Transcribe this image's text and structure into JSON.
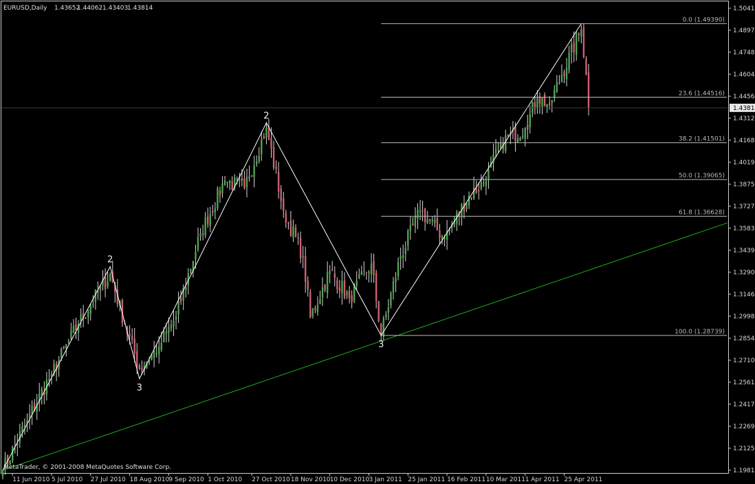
{
  "header": {
    "symbol": "EURUSD,Daily",
    "open": "1.43652",
    "high": "1.44062",
    "low": "1.43403",
    "close": "1.43814"
  },
  "footer": "MetaTrader, © 2001-2008 MetaQuotes Software Corp.",
  "colors": {
    "background": "#000000",
    "bull": "#4ea64e",
    "bear": "#d06070",
    "wick": "#d8d8d8",
    "trendline": "#22aa22",
    "fibonacci": "#bdbdbd",
    "zigzag": "#ffffff",
    "axis_text": "#d8d8d8",
    "current_price_box": "#e8e8e8"
  },
  "chart_data": {
    "type": "candlestick",
    "y_axis_ticks": [
      "1.50410",
      "1.48970",
      "1.47485",
      "1.46045",
      "1.44560",
      "1.43120",
      "1.41680",
      "1.40195",
      "1.38755",
      "1.37270",
      "1.35830",
      "1.34390",
      "1.32905",
      "1.31465",
      "1.29980",
      "1.28540",
      "1.27100",
      "1.25615",
      "1.24175",
      "1.22690",
      "1.21250",
      "1.19810"
    ],
    "x_axis_ticks": [
      "11 Jun 2010",
      "5 Jul 2010",
      "27 Jul 2010",
      "18 Aug 2010",
      "9 Sep 2010",
      "1 Oct 2010",
      "27 Oct 2010",
      "18 Nov 2010",
      "10 Dec 2010",
      "3 Jan 2011",
      "25 Jan 2011",
      "16 Feb 2011",
      "10 Mar 2011",
      "1 Apr 2011",
      "25 Apr 2011"
    ],
    "ylim": [
      1.1981,
      1.5041
    ],
    "current_price": "1.43814",
    "waypoints": [
      {
        "date": "2010-06-07",
        "close": 1.1981
      },
      {
        "date": "2010-06-21",
        "close": 1.231
      },
      {
        "date": "2010-07-05",
        "close": 1.262
      },
      {
        "date": "2010-07-20",
        "close": 1.295
      },
      {
        "date": "2010-08-06",
        "close": 1.328
      },
      {
        "date": "2010-08-15",
        "close": 1.295
      },
      {
        "date": "2010-08-24",
        "close": 1.265
      },
      {
        "date": "2010-09-03",
        "close": 1.28
      },
      {
        "date": "2010-09-14",
        "close": 1.3
      },
      {
        "date": "2010-09-28",
        "close": 1.355
      },
      {
        "date": "2010-10-12",
        "close": 1.39
      },
      {
        "date": "2010-10-22",
        "close": 1.385
      },
      {
        "date": "2010-11-04",
        "close": 1.425
      },
      {
        "date": "2010-11-15",
        "close": 1.37
      },
      {
        "date": "2010-11-25",
        "close": 1.34
      },
      {
        "date": "2010-11-30",
        "close": 1.299
      },
      {
        "date": "2010-12-10",
        "close": 1.33
      },
      {
        "date": "2010-12-22",
        "close": 1.312
      },
      {
        "date": "2011-01-04",
        "close": 1.335
      },
      {
        "date": "2011-01-10",
        "close": 1.288
      },
      {
        "date": "2011-01-20",
        "close": 1.34
      },
      {
        "date": "2011-02-01",
        "close": 1.37
      },
      {
        "date": "2011-02-15",
        "close": 1.352
      },
      {
        "date": "2011-03-01",
        "close": 1.38
      },
      {
        "date": "2011-03-10",
        "close": 1.39
      },
      {
        "date": "2011-03-18",
        "close": 1.415
      },
      {
        "date": "2011-04-01",
        "close": 1.425
      },
      {
        "date": "2011-04-08",
        "close": 1.445
      },
      {
        "date": "2011-04-15",
        "close": 1.44
      },
      {
        "date": "2011-04-22",
        "close": 1.46
      },
      {
        "date": "2011-05-04",
        "close": 1.49
      },
      {
        "date": "2011-05-06",
        "close": 1.46
      },
      {
        "date": "2011-05-09",
        "close": 1.438
      }
    ],
    "zigzag": [
      {
        "date": "2010-06-07",
        "price": 1.1981
      },
      {
        "date": "2010-08-06",
        "price": 1.333
      },
      {
        "date": "2010-08-24",
        "price": 1.2587
      },
      {
        "date": "2010-11-04",
        "price": 1.4282
      },
      {
        "date": "2011-01-10",
        "price": 1.2874
      },
      {
        "date": "2011-05-04",
        "price": 1.4939
      }
    ],
    "wave_labels": [
      {
        "text": "2",
        "date": "2010-08-06",
        "price": 1.333,
        "position": "above"
      },
      {
        "text": "3",
        "date": "2010-08-24",
        "price": 1.2587,
        "position": "below"
      },
      {
        "text": "2",
        "date": "2010-11-04",
        "price": 1.4282,
        "position": "above"
      },
      {
        "text": "3",
        "date": "2011-01-10",
        "price": 1.2874,
        "position": "below"
      }
    ],
    "fibonacci": {
      "start_date": "2011-01-10",
      "levels": [
        {
          "price": 1.4939,
          "label": "0.0 (1.49390)"
        },
        {
          "price": 1.44516,
          "label": "23.6 (1.44516)"
        },
        {
          "price": 1.41501,
          "label": "38.2 (1.41501)"
        },
        {
          "price": 1.39065,
          "label": "50.0 (1.39065)"
        },
        {
          "price": 1.36628,
          "label": "61.8 (1.36628)"
        },
        {
          "price": 1.28739,
          "label": "100.0 (1.28739)"
        }
      ]
    },
    "trendline": {
      "from": {
        "date": "2010-06-07",
        "price": 1.1981
      },
      "to": {
        "date": "2011-05-17",
        "price": 1.362
      }
    }
  }
}
